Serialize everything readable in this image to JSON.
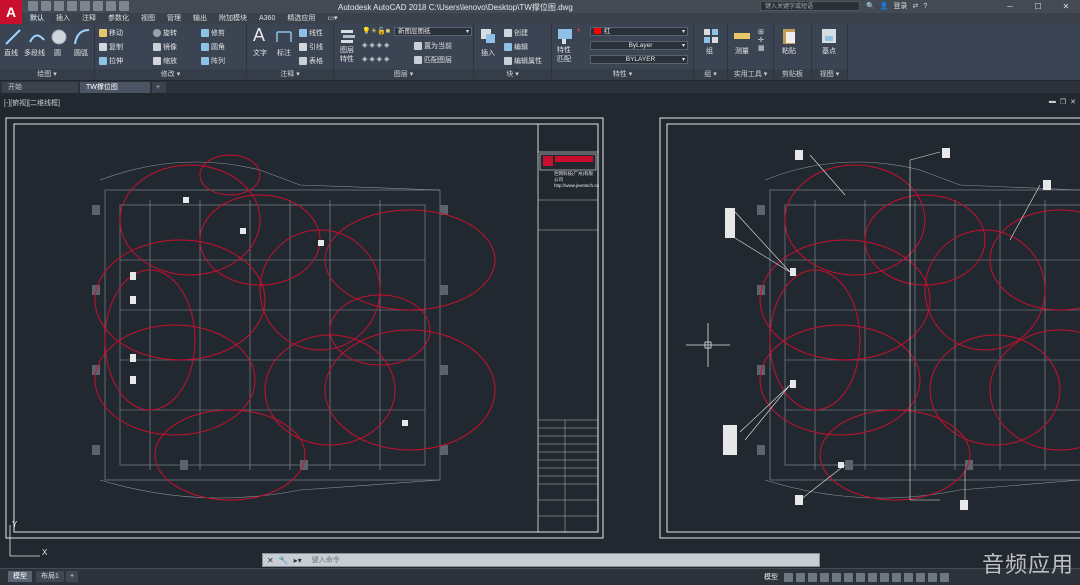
{
  "app": {
    "logo_letter": "A",
    "title": "Autodesk AutoCAD 2018    C:\\Users\\lenovo\\Desktop\\TW撑位图.dwg"
  },
  "title_search": {
    "placeholder": "键入关键字或短语"
  },
  "user": {
    "login_label": "登录"
  },
  "window_controls": {
    "minimize": "─",
    "maximize": "☐",
    "close": "✕"
  },
  "ribbon_tabs": [
    "默认",
    "插入",
    "注释",
    "参数化",
    "视图",
    "管理",
    "输出",
    "附加模块",
    "A360",
    "精选应用"
  ],
  "ribbon": {
    "draw": {
      "title": "绘图 ▾",
      "line": "直线",
      "polyline": "多段线",
      "circle": "圆",
      "arc": "圆弧"
    },
    "modify": {
      "title": "修改 ▾",
      "move": "移动",
      "rotate": "旋转",
      "trim": "修剪",
      "copy": "复制",
      "mirror": "镜像",
      "fillet": "圆角",
      "stretch": "拉伸",
      "scale": "缩放",
      "array": "阵列"
    },
    "annotation": {
      "title": "注释 ▾",
      "text": "文字",
      "dimension": "标注",
      "linear": "线性",
      "leader": "引线",
      "table": "表格"
    },
    "layers": {
      "title": "图层 ▾",
      "layer_props": "图层\n特性",
      "current_layer": "新图层图纸",
      "make_current": "置为当前",
      "match_layer": "匹配图层"
    },
    "block": {
      "title": "块 ▾",
      "insert": "插入",
      "create": "创建",
      "edit": "编辑",
      "edit_attr": "编辑属性"
    },
    "properties": {
      "title": "特性 ▾",
      "match": "特性\n匹配",
      "color": "红",
      "linetype": "ByLayer",
      "lineweight": "BYLAYER"
    },
    "groups": {
      "title": "组 ▾",
      "group": "组"
    },
    "utilities": {
      "title": "实用工具 ▾",
      "measure": "测量"
    },
    "clipboard": {
      "title": "剪贴板",
      "paste": "粘贴"
    },
    "view": {
      "title": "视图 ▾",
      "base": "基点"
    }
  },
  "file_tabs": [
    "开始",
    "TW撑位图"
  ],
  "viewport": {
    "label": "[-][俯视][二维线框]"
  },
  "titleblock": {
    "company": "巨网科技(广州)有限公司",
    "url": "http://www.jeentech.cn"
  },
  "command": {
    "placeholder": "键入命令"
  },
  "layout_tabs": [
    "模型",
    "布局1"
  ],
  "status": {
    "model_label": "模型"
  },
  "watermark": "音频应用"
}
